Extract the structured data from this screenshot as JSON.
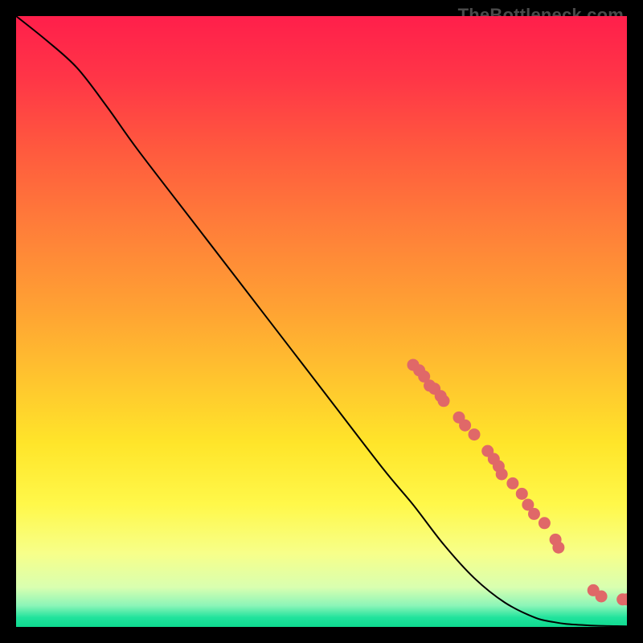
{
  "watermark": "TheBottleneck.com",
  "chart_data": {
    "type": "line",
    "title": "",
    "xlabel": "",
    "ylabel": "",
    "xlim": [
      0,
      100
    ],
    "ylim": [
      0,
      100
    ],
    "curve": {
      "x": [
        0,
        5,
        10,
        15,
        20,
        30,
        40,
        50,
        60,
        65,
        70,
        75,
        80,
        85,
        88,
        90,
        93,
        95,
        97,
        100
      ],
      "y": [
        100,
        96,
        91.5,
        85,
        78,
        65,
        52,
        39,
        26,
        20,
        13.5,
        8,
        4,
        1.5,
        0.8,
        0.5,
        0.3,
        0.2,
        0.15,
        0.1
      ]
    },
    "points": [
      {
        "x": 65.0,
        "y": 42.9
      },
      {
        "x": 66.0,
        "y": 42.0
      },
      {
        "x": 66.8,
        "y": 41.0
      },
      {
        "x": 67.7,
        "y": 39.5
      },
      {
        "x": 68.5,
        "y": 39.0
      },
      {
        "x": 69.5,
        "y": 37.8
      },
      {
        "x": 70.0,
        "y": 37.0
      },
      {
        "x": 72.5,
        "y": 34.3
      },
      {
        "x": 73.5,
        "y": 33.0
      },
      {
        "x": 75.0,
        "y": 31.5
      },
      {
        "x": 77.2,
        "y": 28.8
      },
      {
        "x": 78.2,
        "y": 27.5
      },
      {
        "x": 79.0,
        "y": 26.3
      },
      {
        "x": 79.5,
        "y": 25.0
      },
      {
        "x": 81.3,
        "y": 23.5
      },
      {
        "x": 82.8,
        "y": 21.8
      },
      {
        "x": 83.8,
        "y": 20.0
      },
      {
        "x": 84.8,
        "y": 18.5
      },
      {
        "x": 86.5,
        "y": 17.0
      },
      {
        "x": 88.3,
        "y": 14.3
      },
      {
        "x": 88.8,
        "y": 13.0
      },
      {
        "x": 94.5,
        "y": 6.0
      },
      {
        "x": 95.8,
        "y": 5.0
      },
      {
        "x": 99.3,
        "y": 4.5
      },
      {
        "x": 100.0,
        "y": 4.5
      }
    ],
    "gradient_stops": [
      {
        "offset": 0.0,
        "color": "#ff1f4b"
      },
      {
        "offset": 0.1,
        "color": "#ff3547"
      },
      {
        "offset": 0.22,
        "color": "#ff5a3e"
      },
      {
        "offset": 0.35,
        "color": "#ff7f39"
      },
      {
        "offset": 0.48,
        "color": "#ffa233"
      },
      {
        "offset": 0.6,
        "color": "#ffc62e"
      },
      {
        "offset": 0.7,
        "color": "#ffe52a"
      },
      {
        "offset": 0.8,
        "color": "#fff84a"
      },
      {
        "offset": 0.88,
        "color": "#f7ff8a"
      },
      {
        "offset": 0.935,
        "color": "#d9ffb0"
      },
      {
        "offset": 0.965,
        "color": "#8cf5b8"
      },
      {
        "offset": 0.985,
        "color": "#1fe39c"
      },
      {
        "offset": 1.0,
        "color": "#0fd98f"
      }
    ],
    "point_color": "#e06868",
    "line_color": "#000000"
  }
}
